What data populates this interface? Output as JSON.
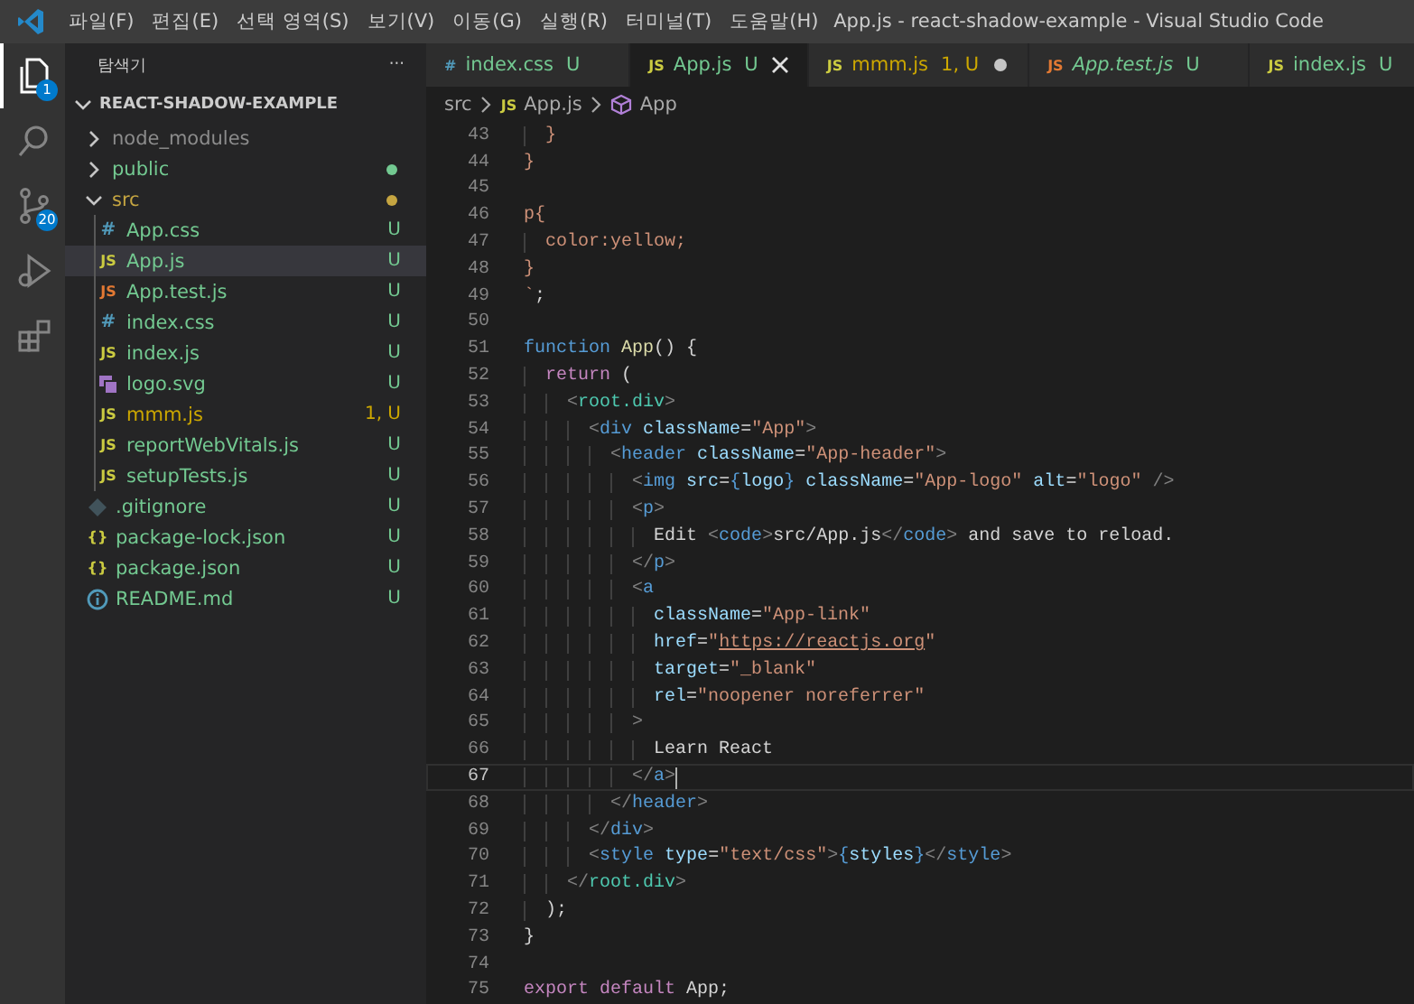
{
  "titlebar": {
    "menu": [
      "파일(F)",
      "편집(E)",
      "선택 영역(S)",
      "보기(V)",
      "이동(G)",
      "실행(R)",
      "터미널(T)",
      "도움말(H)"
    ],
    "title": "App.js - react-shadow-example - Visual Studio Code"
  },
  "activity": [
    {
      "kind": "explorer",
      "selected": true,
      "badge": "1"
    },
    {
      "kind": "search",
      "selected": false
    },
    {
      "kind": "scm",
      "selected": false,
      "badge": "20"
    },
    {
      "kind": "run",
      "selected": false
    },
    {
      "kind": "extensions",
      "selected": false
    }
  ],
  "explorer": {
    "title": "탐색기",
    "more": "···",
    "section": "REACT-SHADOW-EXAMPLE",
    "tree": [
      {
        "label": "node_modules",
        "kind": "folder",
        "expanded": false,
        "dot": false,
        "color": "#8c8c8c",
        "selected": false
      },
      {
        "label": "public",
        "kind": "folder",
        "expanded": false,
        "dot": true,
        "color": "#73c991",
        "selected": false
      },
      {
        "label": "src",
        "kind": "folder",
        "expanded": true,
        "dot": true,
        "color": "#c5a541",
        "selected": false,
        "children": [
          {
            "label": "App.css",
            "kind": "css",
            "icon": "#",
            "status": "U",
            "color": "#73c991",
            "selected": false
          },
          {
            "label": "App.js",
            "kind": "js",
            "icon": "JS",
            "status": "U",
            "color": "#73c991",
            "selected": true
          },
          {
            "label": "App.test.js",
            "kind": "test",
            "icon": "JS",
            "status": "U",
            "color": "#73c991",
            "selected": false
          },
          {
            "label": "index.css",
            "kind": "css",
            "icon": "#",
            "status": "U",
            "color": "#73c991",
            "selected": false
          },
          {
            "label": "index.js",
            "kind": "js",
            "icon": "JS",
            "status": "U",
            "color": "#73c991",
            "selected": false
          },
          {
            "label": "logo.svg",
            "kind": "svg",
            "status": "U",
            "color": "#73c991",
            "selected": false
          },
          {
            "label": "mmm.js",
            "kind": "js",
            "icon": "JS",
            "status": "1, U",
            "color": "#cca700",
            "selected": false
          },
          {
            "label": "reportWebVitals.js",
            "kind": "js",
            "icon": "JS",
            "status": "U",
            "color": "#73c991",
            "selected": false
          },
          {
            "label": "setupTests.js",
            "kind": "js",
            "icon": "JS",
            "status": "U",
            "color": "#73c991",
            "selected": false
          }
        ]
      },
      {
        "label": ".gitignore",
        "kind": "git",
        "status": "U",
        "color": "#73c991",
        "selected": false
      },
      {
        "label": "package-lock.json",
        "kind": "json",
        "icon": "{}",
        "status": "U",
        "color": "#73c991",
        "selected": false
      },
      {
        "label": "package.json",
        "kind": "json",
        "icon": "{}",
        "status": "U",
        "color": "#73c991",
        "selected": false
      },
      {
        "label": "README.md",
        "kind": "info",
        "status": "U",
        "color": "#73c991",
        "selected": false
      }
    ]
  },
  "tabs": [
    {
      "label": "index.css",
      "kind": "css",
      "icon": "#",
      "status": "U",
      "color": "#73c991",
      "selected": false,
      "modified": false,
      "preview": false
    },
    {
      "label": "App.js",
      "kind": "js",
      "icon": "JS",
      "status": "U",
      "color": "#73c991",
      "selected": true,
      "modified": false,
      "preview": false
    },
    {
      "label": "mmm.js",
      "kind": "js",
      "icon": "JS",
      "status": "1, U",
      "color": "#cca700",
      "selected": false,
      "modified": true,
      "preview": false
    },
    {
      "label": "App.test.js",
      "kind": "test",
      "icon": "JS",
      "status": "U",
      "color": "#73c991",
      "selected": false,
      "modified": false,
      "preview": true
    },
    {
      "label": "index.js",
      "kind": "js",
      "icon": "JS",
      "status": "U",
      "color": "#73c991",
      "selected": false,
      "modified": false,
      "preview": false
    }
  ],
  "breadcrumb": [
    {
      "kind": "folder",
      "label": "src"
    },
    {
      "kind": "js",
      "icon": "JS",
      "label": "App.js"
    },
    {
      "kind": "symbol",
      "label": "App"
    }
  ],
  "code": [
    {
      "n": "43",
      "current": false,
      "tokens": [
        {
          "kind": "str",
          "text": "  }"
        }
      ]
    },
    {
      "n": "44",
      "current": false,
      "tokens": [
        {
          "kind": "str",
          "text": "}"
        }
      ]
    },
    {
      "n": "45",
      "current": false
    },
    {
      "n": "46",
      "current": false,
      "tokens": [
        {
          "kind": "str",
          "text": "p{"
        }
      ]
    },
    {
      "n": "47",
      "current": false,
      "tokens": [
        {
          "kind": "str",
          "text": "  color:yellow;"
        }
      ]
    },
    {
      "n": "48",
      "current": false,
      "tokens": [
        {
          "kind": "str",
          "text": "}"
        }
      ]
    },
    {
      "n": "49",
      "current": false,
      "tokens": [
        {
          "kind": "str",
          "text": "`"
        },
        {
          "kind": "text",
          "text": ";"
        }
      ]
    },
    {
      "n": "50",
      "current": false
    },
    {
      "n": "51",
      "current": false,
      "tokens": [
        {
          "kind": "storage",
          "text": "function "
        },
        {
          "kind": "fn",
          "text": "App"
        },
        {
          "kind": "text",
          "text": "() {"
        }
      ]
    },
    {
      "n": "52",
      "current": false,
      "tokens": [
        {
          "kind": "kw",
          "text": "  return"
        },
        {
          "kind": "text",
          "text": " ("
        }
      ]
    },
    {
      "n": "53",
      "current": false,
      "tokens": [
        {
          "kind": "punc",
          "text": "    <"
        },
        {
          "kind": "comp",
          "text": "root.div"
        },
        {
          "kind": "punc",
          "text": ">"
        }
      ]
    },
    {
      "n": "54",
      "current": false,
      "tokens": [
        {
          "kind": "punc",
          "text": "      <"
        },
        {
          "kind": "tag",
          "text": "div"
        },
        {
          "kind": "attr",
          "text": " className"
        },
        {
          "kind": "text",
          "text": "="
        },
        {
          "kind": "str",
          "text": "\"App\""
        },
        {
          "kind": "punc",
          "text": ">"
        }
      ]
    },
    {
      "n": "55",
      "current": false,
      "tokens": [
        {
          "kind": "punc",
          "text": "        <"
        },
        {
          "kind": "tag",
          "text": "header"
        },
        {
          "kind": "attr",
          "text": " className"
        },
        {
          "kind": "text",
          "text": "="
        },
        {
          "kind": "str",
          "text": "\"App-header\""
        },
        {
          "kind": "punc",
          "text": ">"
        }
      ]
    },
    {
      "n": "56",
      "current": false,
      "tokens": [
        {
          "kind": "punc",
          "text": "          <"
        },
        {
          "kind": "tag",
          "text": "img"
        },
        {
          "kind": "attr",
          "text": " src"
        },
        {
          "kind": "text",
          "text": "="
        },
        {
          "kind": "tag",
          "text": "{"
        },
        {
          "kind": "attr",
          "text": "logo"
        },
        {
          "kind": "tag",
          "text": "}"
        },
        {
          "kind": "attr",
          "text": " className"
        },
        {
          "kind": "text",
          "text": "="
        },
        {
          "kind": "str",
          "text": "\"App-logo\""
        },
        {
          "kind": "attr",
          "text": " alt"
        },
        {
          "kind": "text",
          "text": "="
        },
        {
          "kind": "str",
          "text": "\"logo\""
        },
        {
          "kind": "punc",
          "text": " />"
        }
      ]
    },
    {
      "n": "57",
      "current": false,
      "tokens": [
        {
          "kind": "punc",
          "text": "          <"
        },
        {
          "kind": "tag",
          "text": "p"
        },
        {
          "kind": "punc",
          "text": ">"
        }
      ]
    },
    {
      "n": "58",
      "current": false,
      "tokens": [
        {
          "kind": "text",
          "text": "            Edit "
        },
        {
          "kind": "punc",
          "text": "<"
        },
        {
          "kind": "tag",
          "text": "code"
        },
        {
          "kind": "punc",
          "text": ">"
        },
        {
          "kind": "text",
          "text": "src/App.js"
        },
        {
          "kind": "punc",
          "text": "</"
        },
        {
          "kind": "tag",
          "text": "code"
        },
        {
          "kind": "punc",
          "text": ">"
        },
        {
          "kind": "text",
          "text": " and save to reload."
        }
      ]
    },
    {
      "n": "59",
      "current": false,
      "tokens": [
        {
          "kind": "punc",
          "text": "          </"
        },
        {
          "kind": "tag",
          "text": "p"
        },
        {
          "kind": "punc",
          "text": ">"
        }
      ]
    },
    {
      "n": "60",
      "current": false,
      "tokens": [
        {
          "kind": "punc",
          "text": "          <"
        },
        {
          "kind": "tag",
          "text": "a"
        }
      ]
    },
    {
      "n": "61",
      "current": false,
      "tokens": [
        {
          "kind": "attr",
          "text": "            className"
        },
        {
          "kind": "text",
          "text": "="
        },
        {
          "kind": "str",
          "text": "\"App-link\""
        }
      ]
    },
    {
      "n": "62",
      "current": false,
      "tokens": [
        {
          "kind": "attr",
          "text": "            href"
        },
        {
          "kind": "text",
          "text": "="
        },
        {
          "kind": "str",
          "text": "\""
        },
        {
          "kind": "url",
          "text": "https://reactjs.org"
        },
        {
          "kind": "str",
          "text": "\""
        }
      ]
    },
    {
      "n": "63",
      "current": false,
      "tokens": [
        {
          "kind": "attr",
          "text": "            target"
        },
        {
          "kind": "text",
          "text": "="
        },
        {
          "kind": "str",
          "text": "\"_blank\""
        }
      ]
    },
    {
      "n": "64",
      "current": false,
      "tokens": [
        {
          "kind": "attr",
          "text": "            rel"
        },
        {
          "kind": "text",
          "text": "="
        },
        {
          "kind": "str",
          "text": "\"noopener noreferrer\""
        }
      ]
    },
    {
      "n": "65",
      "current": false,
      "tokens": [
        {
          "kind": "punc",
          "text": "          >"
        }
      ]
    },
    {
      "n": "66",
      "current": false,
      "tokens": [
        {
          "kind": "text",
          "text": "            Learn React"
        }
      ]
    },
    {
      "n": "67",
      "current": true,
      "tokens": [
        {
          "kind": "punc",
          "text": "          </"
        },
        {
          "kind": "tag",
          "text": "a"
        },
        {
          "kind": "punc",
          "text": ">"
        }
      ]
    },
    {
      "n": "68",
      "current": false,
      "tokens": [
        {
          "kind": "punc",
          "text": "        </"
        },
        {
          "kind": "tag",
          "text": "header"
        },
        {
          "kind": "punc",
          "text": ">"
        }
      ]
    },
    {
      "n": "69",
      "current": false,
      "tokens": [
        {
          "kind": "punc",
          "text": "      </"
        },
        {
          "kind": "tag",
          "text": "div"
        },
        {
          "kind": "punc",
          "text": ">"
        }
      ]
    },
    {
      "n": "70",
      "current": false,
      "tokens": [
        {
          "kind": "punc",
          "text": "      <"
        },
        {
          "kind": "tag",
          "text": "style"
        },
        {
          "kind": "attr",
          "text": " type"
        },
        {
          "kind": "text",
          "text": "="
        },
        {
          "kind": "str",
          "text": "\"text/css\""
        },
        {
          "kind": "punc",
          "text": ">"
        },
        {
          "kind": "tag",
          "text": "{"
        },
        {
          "kind": "attr",
          "text": "styles"
        },
        {
          "kind": "tag",
          "text": "}"
        },
        {
          "kind": "punc",
          "text": "</"
        },
        {
          "kind": "tag",
          "text": "style"
        },
        {
          "kind": "punc",
          "text": ">"
        }
      ]
    },
    {
      "n": "71",
      "current": false,
      "tokens": [
        {
          "kind": "punc",
          "text": "    </"
        },
        {
          "kind": "comp",
          "text": "root.div"
        },
        {
          "kind": "punc",
          "text": ">"
        }
      ]
    },
    {
      "n": "72",
      "current": false,
      "tokens": [
        {
          "kind": "text",
          "text": "  );"
        }
      ]
    },
    {
      "n": "73",
      "current": false,
      "tokens": [
        {
          "kind": "text",
          "text": "}"
        }
      ]
    },
    {
      "n": "74",
      "current": false
    },
    {
      "n": "75",
      "current": false,
      "tokens": [
        {
          "kind": "kw",
          "text": "export default "
        },
        {
          "kind": "text",
          "text": "App;"
        }
      ]
    }
  ]
}
